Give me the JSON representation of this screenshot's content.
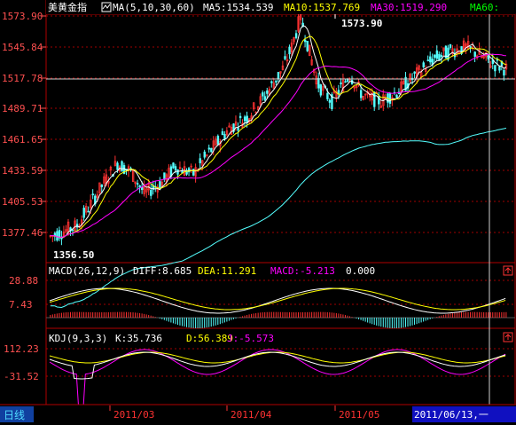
{
  "main_panel": {
    "instrument": "美黄金指",
    "ma_indicator": "MA(5,10,30,60)",
    "ma5": "MA5:1534.539",
    "ma10": "MA10:1537.769",
    "ma30": "MA30:1519.290",
    "ma60": "MA60:",
    "peak_label": "1573.90",
    "low_label": "1356.50",
    "y_ticks": [
      "1573.90",
      "1545.84",
      "1517.78",
      "1489.71",
      "1461.65",
      "1433.59",
      "1405.53",
      "1377.46"
    ]
  },
  "macd_panel": {
    "label": "MACD(26,12,9)",
    "diff": "DIFF:8.685",
    "dea": "DEA:11.291",
    "macd": "MACD:-5.213",
    "zero": "0.000",
    "y_ticks": [
      "28.88",
      "7.43"
    ]
  },
  "kdj_panel": {
    "label": "KDJ(9,3,3)",
    "k": "K:35.736",
    "d": "D:56.389",
    "j": "J:-5.573",
    "y_ticks": [
      "112.23",
      "-31.52"
    ]
  },
  "footer": {
    "period": "日线",
    "dates": [
      "2011/03",
      "2011/04",
      "2011/05"
    ],
    "cursor_date": "2011/06/13,一"
  },
  "colors": {
    "background": "#000000",
    "up": "#ff3232",
    "down": "#54ffff",
    "ma5": "#ffffff",
    "ma10": "#ffff00",
    "ma30": "#ff00ff",
    "ma60": "#00ff00",
    "grid": "#a00000",
    "axis_text": "#ff5050"
  },
  "icons": [
    "ma-indicator-icon",
    "panel-expand-icon"
  ],
  "chart_data": {
    "type": "candlestick",
    "ylim": [
      1356.5,
      1573.9
    ],
    "trend_points": [
      [
        0,
        1370
      ],
      [
        12,
        1380
      ],
      [
        24,
        1420
      ],
      [
        30,
        1438
      ],
      [
        36,
        1430
      ],
      [
        42,
        1410
      ],
      [
        50,
        1420
      ],
      [
        56,
        1435
      ],
      [
        64,
        1428
      ],
      [
        72,
        1450
      ],
      [
        80,
        1470
      ],
      [
        88,
        1480
      ],
      [
        96,
        1500
      ],
      [
        104,
        1525
      ],
      [
        108,
        1545
      ],
      [
        112,
        1573.9
      ],
      [
        116,
        1540
      ],
      [
        120,
        1510
      ],
      [
        126,
        1495
      ],
      [
        134,
        1520
      ],
      [
        140,
        1500
      ],
      [
        148,
        1495
      ],
      [
        156,
        1505
      ],
      [
        164,
        1520
      ],
      [
        172,
        1535
      ],
      [
        180,
        1542
      ],
      [
        186,
        1545
      ],
      [
        192,
        1538
      ],
      [
        198,
        1530
      ],
      [
        204,
        1525
      ]
    ]
  }
}
